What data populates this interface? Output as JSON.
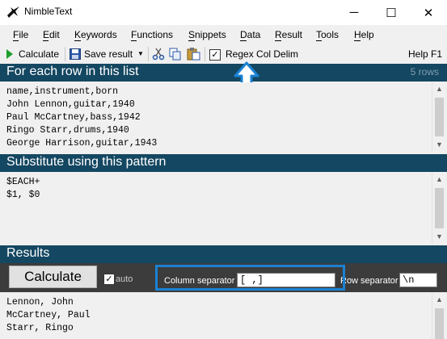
{
  "window": {
    "title": "NimbleText",
    "minimize_glyph": "─",
    "maximize_glyph": "☐",
    "close_glyph": "✕"
  },
  "menu": [
    "File",
    "Edit",
    "Keywords",
    "Functions",
    "Snippets",
    "Data",
    "Result",
    "Tools",
    "Help"
  ],
  "menu_mnemonics": [
    "F",
    "E",
    "K",
    "F",
    "S",
    "D",
    "R",
    "T",
    "H"
  ],
  "toolbar": {
    "calculate_label": "Calculate",
    "save_result_label": "Save result",
    "regex_col_delim_label": "Regex Col Delim",
    "regex_checked": true,
    "help_label": "Help F1"
  },
  "sections": {
    "input_header": "For each row in this list",
    "row_count": "5 rows",
    "pattern_header": "Substitute using this pattern",
    "results_header": "Results"
  },
  "input_lines": [
    "name,instrument,born",
    "John Lennon,guitar,1940",
    "Paul McCartney,bass,1942",
    "Ringo Starr,drums,1940",
    "George Harrison,guitar,1943"
  ],
  "pattern_lines": [
    "$EACH+",
    "$1, $0"
  ],
  "results_bar": {
    "calculate_label": "Calculate",
    "auto_label": "auto",
    "auto_checked": true,
    "column_separator_label": "Column separator",
    "column_separator_value": "[ ,]",
    "row_separator_label": "Row separator",
    "row_separator_value": "\\n"
  },
  "result_lines": [
    "Lennon, John",
    "McCartney, Paul",
    "Starr, Ringo"
  ],
  "colors": {
    "section_header": "#144761",
    "results_bar": "#3c3c3c",
    "highlight": "#1a82d4",
    "calculate_icon": "#1e9e2a"
  }
}
